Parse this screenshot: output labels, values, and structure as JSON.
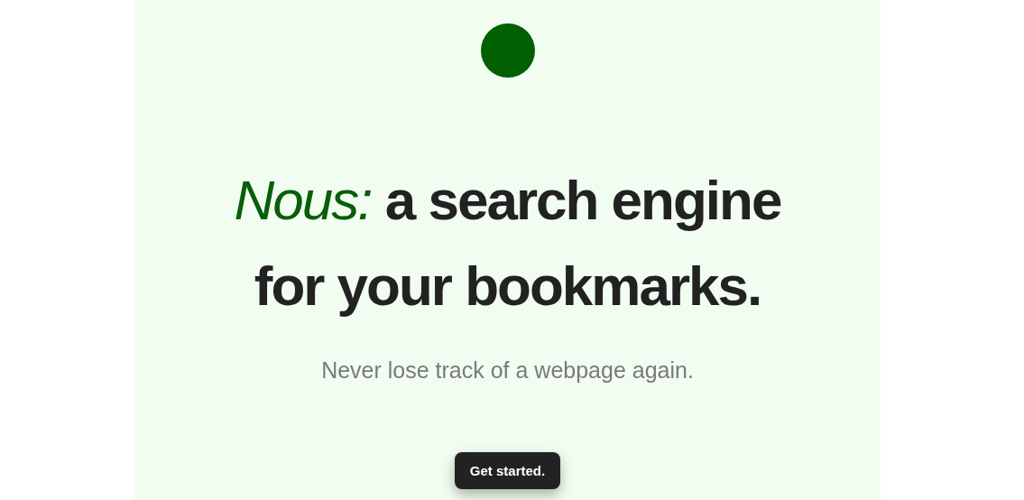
{
  "hero": {
    "headline": "*Nous:* a search engine for your bookmarks.",
    "tagline": "Never lose track of a webpage again.",
    "button": "Get started."
  }
}
